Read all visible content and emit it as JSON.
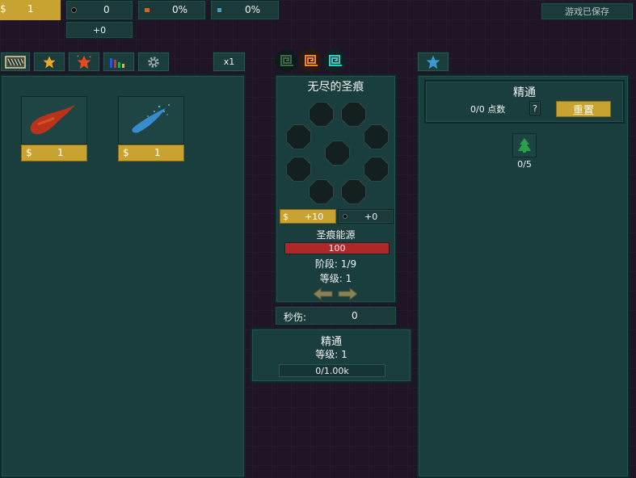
{
  "top_bar": {
    "gold": {
      "symbol": "$",
      "value": "1"
    },
    "essence": {
      "value": "0",
      "rate": "+0"
    },
    "orange_pct": "0%",
    "blue_pct": "0%",
    "saved": "游戏已保存"
  },
  "tabs": {
    "speed": "x1"
  },
  "shop": {
    "items": [
      {
        "icon": "red-comet",
        "price_symbol": "$",
        "price": "1"
      },
      {
        "icon": "blue-comet",
        "price_symbol": "$",
        "price": "1"
      }
    ]
  },
  "stigmata": {
    "title": "无尽的圣痕",
    "gold_bonus": "+10",
    "gold_symbol": "$",
    "essence_bonus": "+0",
    "energy_label": "圣痕能源",
    "energy_value": "100",
    "energy_fill": 1.0,
    "stage": "阶段: 1/9",
    "level": "等级: 1",
    "dps_label": "秒伤:",
    "dps_value": "0"
  },
  "mastery_center": {
    "title": "精通",
    "level": "等级: 1",
    "progress": "0/1.00k",
    "progress_fill": 0.0
  },
  "mastery_right": {
    "title": "精通",
    "points": "0/0 点数",
    "help": "?",
    "reset": "重置",
    "node_count": "0/5"
  },
  "colors": {
    "gold": "#c9a332",
    "panel": "#1a3e3d",
    "energy_bar": "#b0272a"
  }
}
